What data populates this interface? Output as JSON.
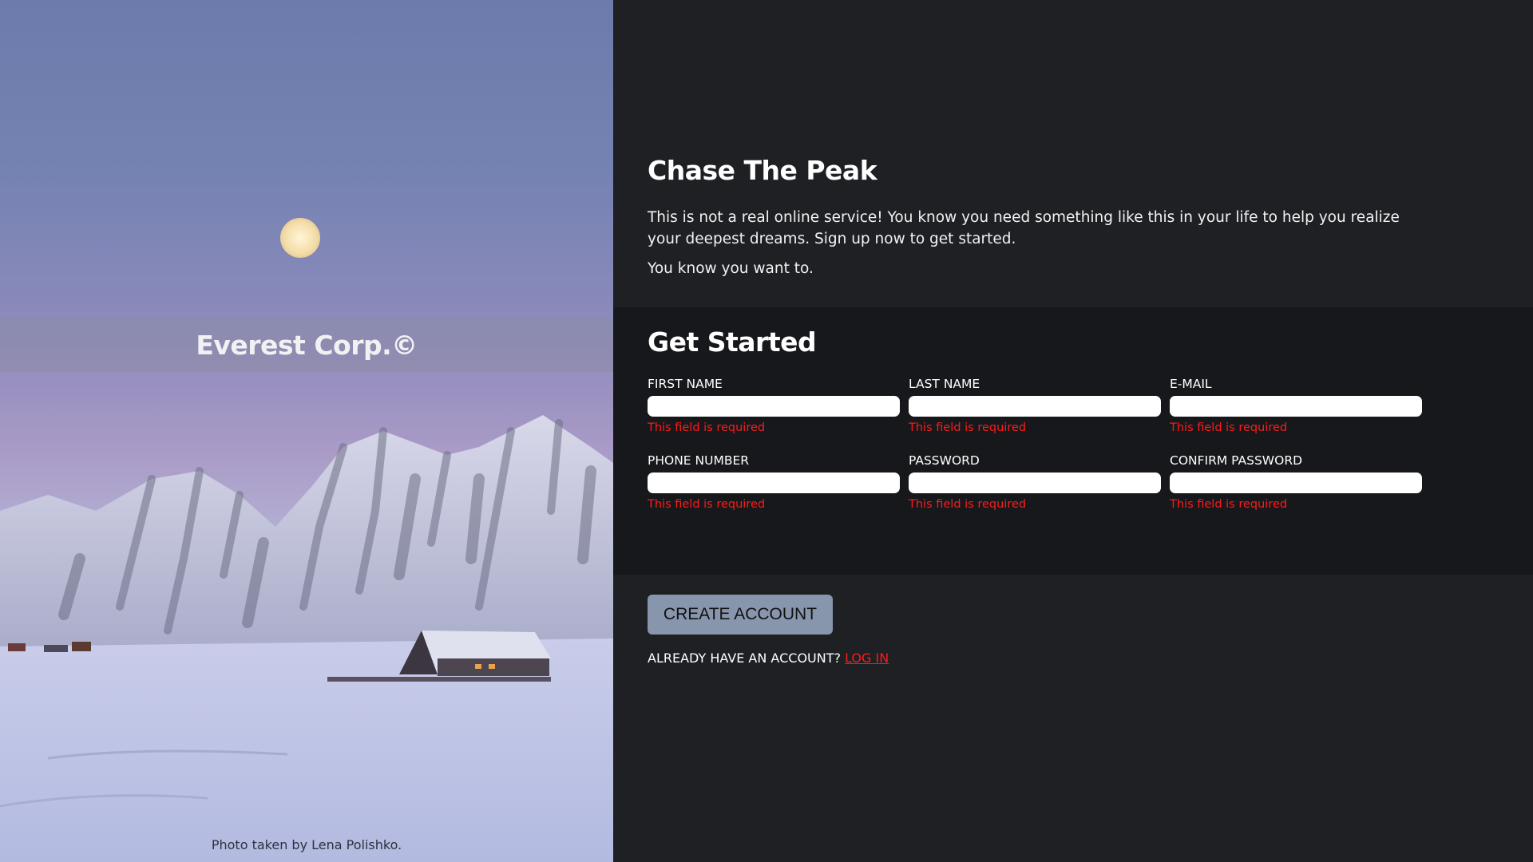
{
  "hero": {
    "brand": "Everest Corp.©",
    "credit": "Photo taken by Lena Polishko."
  },
  "intro": {
    "title": "Chase The Peak",
    "paragraph1": "This is not a real online service! You know you need something like this in your life to help you realize your deepest dreams. Sign up now to get started.",
    "paragraph2": "You know you want to."
  },
  "form": {
    "title": "Get Started",
    "fields": [
      {
        "label": "FIRST NAME",
        "value": "",
        "error": "This field is required"
      },
      {
        "label": "LAST NAME",
        "value": "",
        "error": "This field is required"
      },
      {
        "label": "E-MAIL",
        "value": "",
        "error": "This field is required"
      },
      {
        "label": "PHONE NUMBER",
        "value": "",
        "error": "This field is required"
      },
      {
        "label": "PASSWORD",
        "value": "",
        "error": "This field is required"
      },
      {
        "label": "CONFIRM PASSWORD",
        "value": "",
        "error": "This field is required"
      }
    ]
  },
  "actions": {
    "create_label": "CREATE ACCOUNT",
    "login_prompt": "ALREADY HAVE AN ACCOUNT?",
    "login_link": "LOG IN"
  },
  "colors": {
    "background": "#1e2024",
    "form_background": "#17181b",
    "error": "#ff1a1a",
    "button": "#8796ad"
  }
}
